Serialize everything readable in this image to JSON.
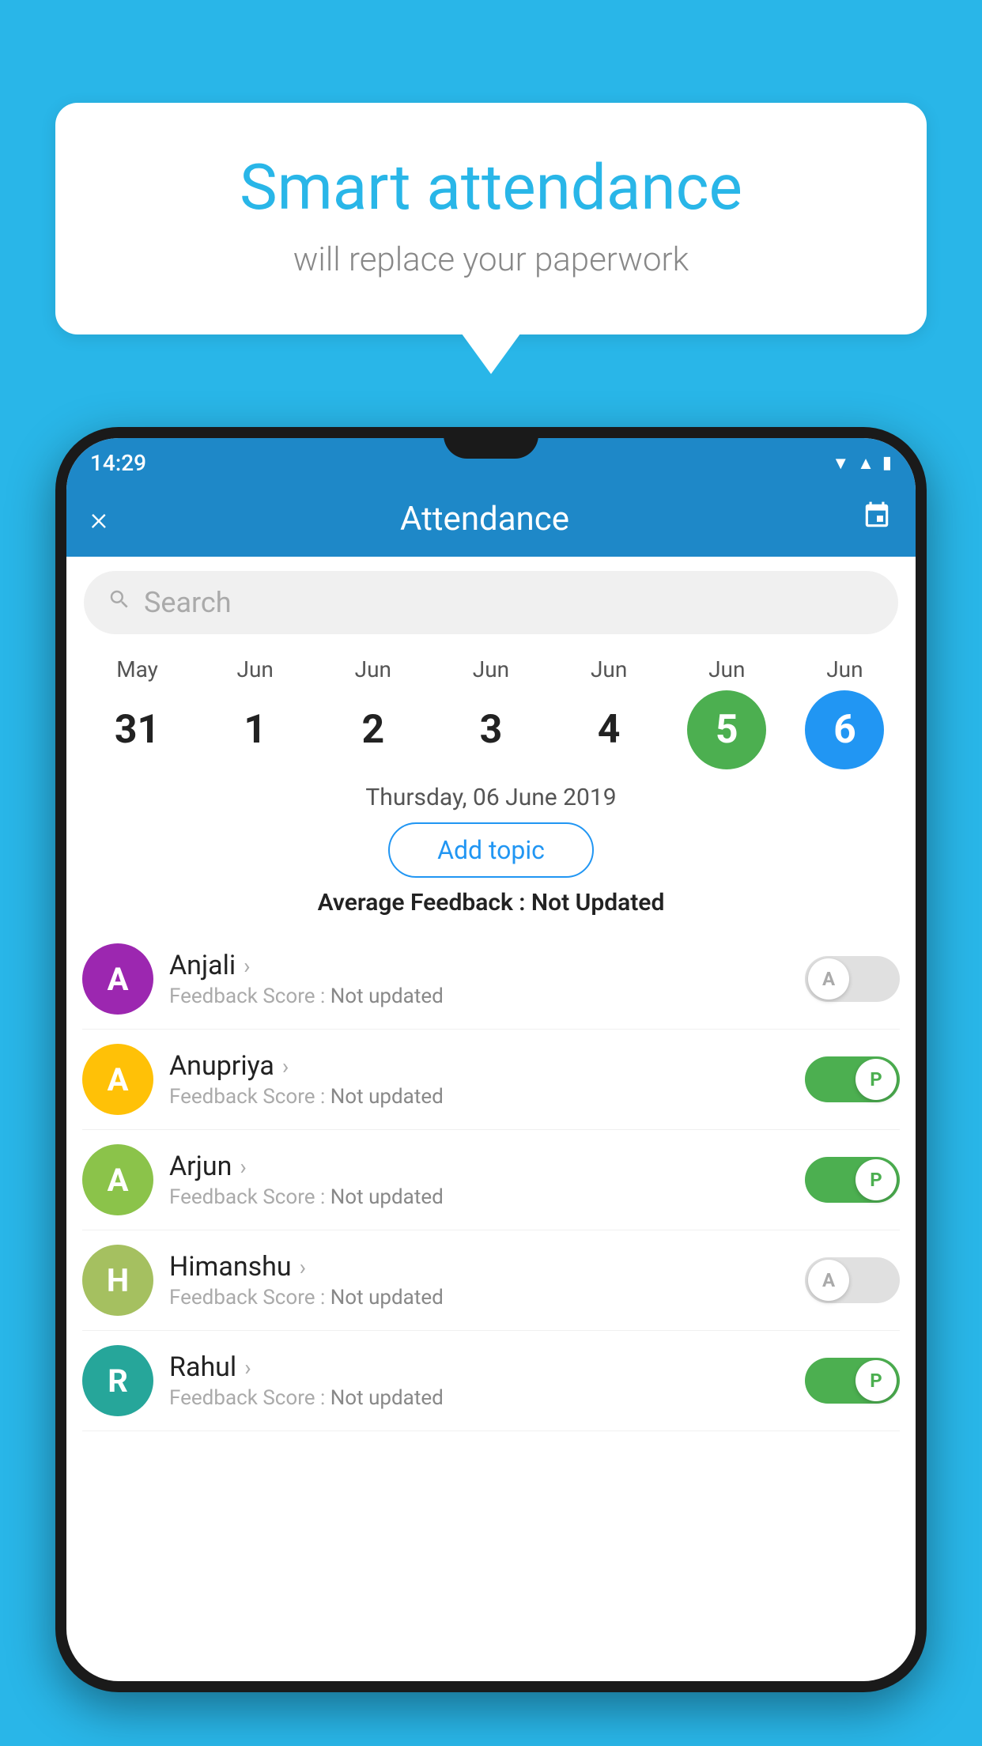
{
  "background_color": "#29b6e8",
  "speech_bubble": {
    "title": "Smart attendance",
    "subtitle": "will replace your paperwork"
  },
  "status_bar": {
    "time": "14:29",
    "icons": [
      "wifi",
      "signal",
      "battery"
    ]
  },
  "app_header": {
    "title": "Attendance",
    "close_label": "×",
    "calendar_icon": "📅"
  },
  "search": {
    "placeholder": "Search"
  },
  "calendar": {
    "days": [
      {
        "month": "May",
        "date": "31",
        "style": "normal"
      },
      {
        "month": "Jun",
        "date": "1",
        "style": "normal"
      },
      {
        "month": "Jun",
        "date": "2",
        "style": "normal"
      },
      {
        "month": "Jun",
        "date": "3",
        "style": "normal"
      },
      {
        "month": "Jun",
        "date": "4",
        "style": "normal"
      },
      {
        "month": "Jun",
        "date": "5",
        "style": "today"
      },
      {
        "month": "Jun",
        "date": "6",
        "style": "selected"
      }
    ]
  },
  "selected_date": "Thursday, 06 June 2019",
  "add_topic_label": "Add topic",
  "average_feedback": {
    "label": "Average Feedback : ",
    "value": "Not Updated"
  },
  "students": [
    {
      "name": "Anjali",
      "initial": "A",
      "avatar_color": "purple",
      "feedback_label": "Feedback Score : ",
      "feedback_value": "Not updated",
      "attendance": "A",
      "toggle_state": "off"
    },
    {
      "name": "Anupriya",
      "initial": "A",
      "avatar_color": "yellow",
      "feedback_label": "Feedback Score : ",
      "feedback_value": "Not updated",
      "attendance": "P",
      "toggle_state": "on"
    },
    {
      "name": "Arjun",
      "initial": "A",
      "avatar_color": "light-green",
      "feedback_label": "Feedback Score : ",
      "feedback_value": "Not updated",
      "attendance": "P",
      "toggle_state": "on"
    },
    {
      "name": "Himanshu",
      "initial": "H",
      "avatar_color": "olive",
      "feedback_label": "Feedback Score : ",
      "feedback_value": "Not updated",
      "attendance": "A",
      "toggle_state": "off"
    },
    {
      "name": "Rahul",
      "initial": "R",
      "avatar_color": "teal",
      "feedback_label": "Feedback Score : ",
      "feedback_value": "Not updated",
      "attendance": "P",
      "toggle_state": "on"
    }
  ]
}
